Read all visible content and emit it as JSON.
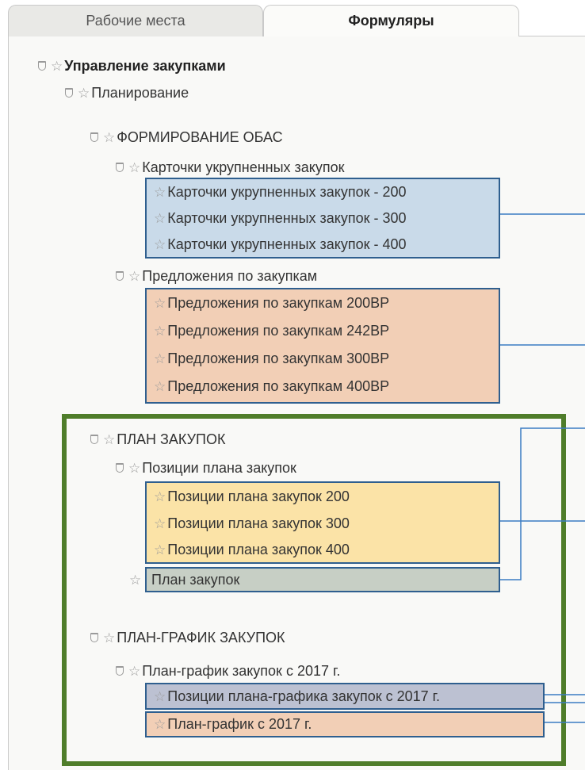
{
  "tabs": [
    {
      "label": "Рабочие места",
      "active": false
    },
    {
      "label": "Формуляры",
      "active": true
    }
  ],
  "tree": {
    "root": "Управление закупками",
    "planning": "Планирование",
    "obas": {
      "title": "ФОРМИРОВАНИЕ ОБАС",
      "cards": {
        "title": "Карточки укрупненных закупок",
        "items": [
          "Карточки укрупненных закупок - 200",
          "Карточки укрупненных закупок - 300",
          "Карточки укрупненных закупок - 400"
        ]
      },
      "proposals": {
        "title": "Предложения по закупкам",
        "items": [
          "Предложения по закупкам 200ВР",
          "Предложения по закупкам 242ВР",
          "Предложения по закупкам 300ВР",
          "Предложения по закупкам 400ВР"
        ]
      }
    },
    "plan": {
      "title": "ПЛАН ЗАКУПОК",
      "positions": {
        "title": "Позиции плана закупок",
        "items": [
          "Позиции плана закупок 200",
          "Позиции плана закупок 300",
          "Позиции плана закупок 400"
        ]
      },
      "plan_item": "План закупок"
    },
    "schedule": {
      "title": "ПЛАН-ГРАФИК ЗАКУПОК",
      "since2017": {
        "title": "План-график закупок с 2017 г.",
        "items": [
          "Позиции плана-графика закупок с 2017 г.",
          "План-график с 2017 г."
        ]
      }
    }
  },
  "colors": {
    "box_border": "#2f5f8f",
    "connector": "#3a7cc4",
    "highlight_frame": "#4f7d2a",
    "blue_fill": "#c9dae9",
    "salmon_fill": "#f2cfb6",
    "yellow_fill": "#fbe3a7",
    "sage_fill": "#c7cfc5",
    "slate_fill": "#bcc1d2"
  },
  "icons": {
    "folder": "folder-icon",
    "favorite": "star-icon"
  }
}
